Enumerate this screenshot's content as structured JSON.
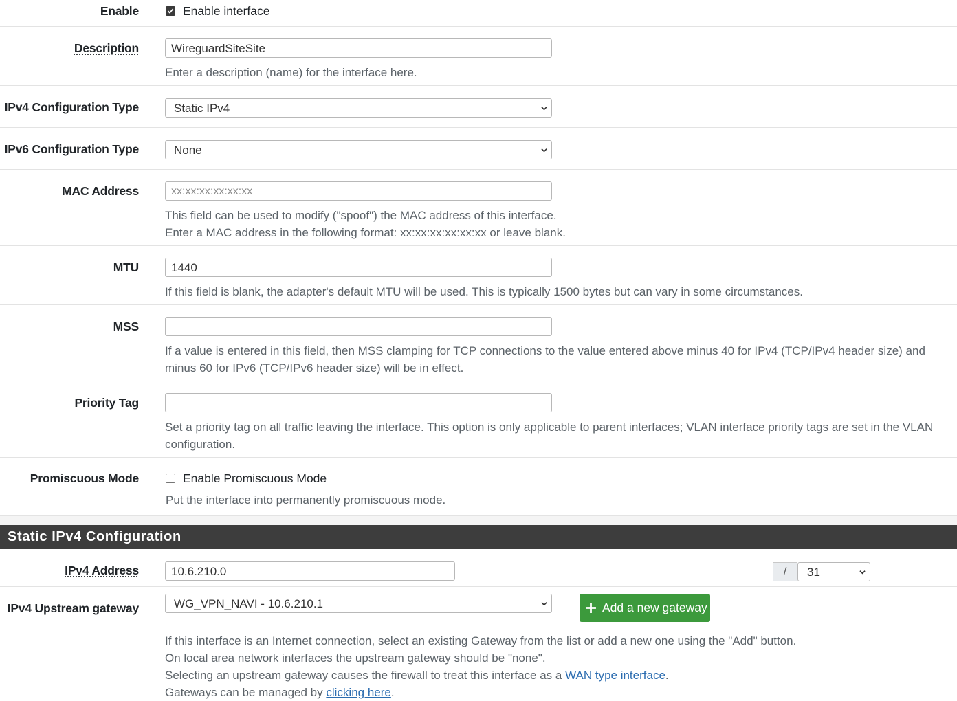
{
  "general": {
    "enable": {
      "label": "Enable",
      "checkbox_label": "Enable interface",
      "checked": true
    },
    "description": {
      "label": "Description",
      "value": "WireguardSiteSite",
      "help": "Enter a description (name) for the interface here."
    },
    "ipv4_type": {
      "label": "IPv4 Configuration Type",
      "value": "Static IPv4"
    },
    "ipv6_type": {
      "label": "IPv6 Configuration Type",
      "value": "None"
    },
    "mac": {
      "label": "MAC Address",
      "placeholder": "xx:xx:xx:xx:xx:xx",
      "help1": "This field can be used to modify (\"spoof\") the MAC address of this interface.",
      "help2": "Enter a MAC address in the following format: xx:xx:xx:xx:xx:xx or leave blank."
    },
    "mtu": {
      "label": "MTU",
      "value": "1440",
      "help": "If this field is blank, the adapter's default MTU will be used. This is typically 1500 bytes but can vary in some circumstances."
    },
    "mss": {
      "label": "MSS",
      "value": "",
      "help1": "If a value is entered in this field, then MSS clamping for TCP connections to the value entered above minus 40 for IPv4 (TCP/IPv4 header size) and",
      "help2": "minus 60 for IPv6 (TCP/IPv6 header size) will be in effect."
    },
    "priority": {
      "label": "Priority Tag",
      "value": "",
      "help1": "Set a priority tag on all traffic leaving the interface. This option is only applicable to parent interfaces; VLAN interface priority tags are set in the VLAN",
      "help2": "configuration."
    },
    "promisc": {
      "label": "Promiscuous Mode",
      "checkbox_label": "Enable Promiscuous Mode",
      "checked": false,
      "help": "Put the interface into permanently promiscuous mode."
    }
  },
  "static_ipv4": {
    "title": "Static IPv4 Configuration",
    "address": {
      "label": "IPv4 Address",
      "value": "10.6.210.0",
      "slash": "/",
      "cidr": "31"
    },
    "gateway": {
      "label": "IPv4 Upstream gateway",
      "value": "WG_VPN_NAVI - 10.6.210.1",
      "add_button": "Add a new gateway",
      "help1": "If this interface is an Internet connection, select an existing Gateway from the list or add a new one using the \"Add\" button.",
      "help2": "On local area network interfaces the upstream gateway should be \"none\".",
      "help3_pre": "Selecting an upstream gateway causes the firewall to treat this interface as a ",
      "help3_link": "WAN type interface",
      "help3_post": ".",
      "help4_pre": "Gateways can be managed by ",
      "help4_link": "clicking here",
      "help4_post": "."
    }
  },
  "colors": {
    "section_header": "#3d3d3d",
    "add_button": "#3c9a3c",
    "link": "#2b6cb0",
    "help_text": "#5c6369"
  }
}
